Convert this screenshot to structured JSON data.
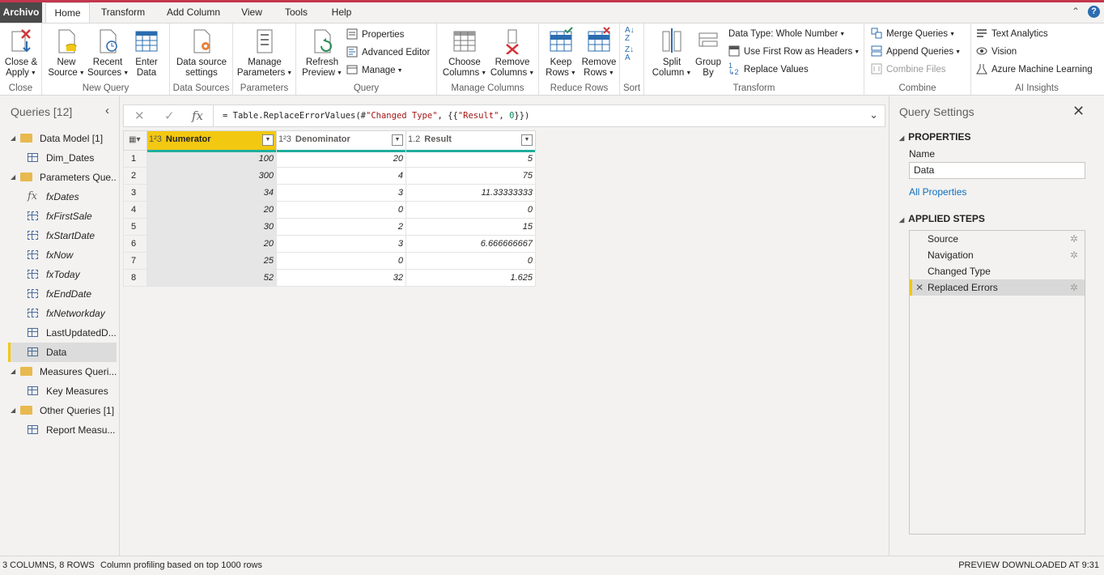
{
  "ribbon_tabs": {
    "file": "Archivo",
    "items": [
      "Home",
      "Transform",
      "Add Column",
      "View",
      "Tools",
      "Help"
    ],
    "active": "Home"
  },
  "ribbon": {
    "close": {
      "close_apply_1": "Close &",
      "close_apply_2": "Apply",
      "label": "Close"
    },
    "new_query": {
      "new_source_1": "New",
      "new_source_2": "Source",
      "recent_sources_1": "Recent",
      "recent_sources_2": "Sources",
      "enter_data_1": "Enter",
      "enter_data_2": "Data",
      "label": "New Query"
    },
    "data_sources": {
      "ds_settings_1": "Data source",
      "ds_settings_2": "settings",
      "label": "Data Sources"
    },
    "parameters": {
      "manage_1": "Manage",
      "manage_2": "Parameters",
      "label": "Parameters"
    },
    "query": {
      "refresh_1": "Refresh",
      "refresh_2": "Preview",
      "properties": "Properties",
      "advanced_editor": "Advanced Editor",
      "manage": "Manage",
      "label": "Query"
    },
    "manage_columns": {
      "choose_1": "Choose",
      "choose_2": "Columns",
      "remove_1": "Remove",
      "remove_2": "Columns",
      "label": "Manage Columns"
    },
    "reduce_rows": {
      "keep_1": "Keep",
      "keep_2": "Rows",
      "remove_1": "Remove",
      "remove_2": "Rows",
      "label": "Reduce Rows"
    },
    "sort": {
      "label": "Sort"
    },
    "transform": {
      "split_1": "Split",
      "split_2": "Column",
      "group_1": "Group",
      "group_2": "By",
      "data_type": "Data Type: Whole Number",
      "first_row": "Use First Row as Headers",
      "replace_values": "Replace Values",
      "label": "Transform"
    },
    "combine": {
      "merge": "Merge Queries",
      "append": "Append Queries",
      "combine_files": "Combine Files",
      "label": "Combine"
    },
    "ai": {
      "text_analytics": "Text Analytics",
      "vision": "Vision",
      "azure_ml": "Azure Machine Learning",
      "label": "AI Insights"
    }
  },
  "queries_panel": {
    "title": "Queries [12]",
    "items": [
      {
        "label": "Data Model [1]",
        "kind": "folder"
      },
      {
        "label": "Dim_Dates",
        "kind": "table"
      },
      {
        "label": "Parameters Que...",
        "kind": "folder"
      },
      {
        "label": "fxDates",
        "kind": "function"
      },
      {
        "label": "fxFirstSale",
        "kind": "param"
      },
      {
        "label": "fxStartDate",
        "kind": "param"
      },
      {
        "label": "fxNow",
        "kind": "param"
      },
      {
        "label": "fxToday",
        "kind": "param"
      },
      {
        "label": "fxEndDate",
        "kind": "param"
      },
      {
        "label": "fxNetworkday",
        "kind": "param"
      },
      {
        "label": "LastUpdatedD...",
        "kind": "table"
      },
      {
        "label": "Data",
        "kind": "table",
        "selected": true
      },
      {
        "label": "Measures Queri...",
        "kind": "folder"
      },
      {
        "label": "Key Measures",
        "kind": "table"
      },
      {
        "label": "Other Queries [1]",
        "kind": "folder"
      },
      {
        "label": "Report Measu...",
        "kind": "table"
      }
    ]
  },
  "formula_bar": {
    "prefix": "= Table.ReplaceErrorValues(#",
    "str1": "\"Changed Type\"",
    "mid": ", {{",
    "str2": "\"Result\"",
    "comma": ", ",
    "num": "0",
    "suffix": "}})"
  },
  "grid": {
    "columns": [
      {
        "type": "1²3",
        "name": "Numerator"
      },
      {
        "type": "1²3",
        "name": "Denominator"
      },
      {
        "type": "1.2",
        "name": "Result"
      }
    ],
    "rows": [
      [
        "1",
        "100",
        "20",
        "5"
      ],
      [
        "2",
        "300",
        "4",
        "75"
      ],
      [
        "3",
        "34",
        "3",
        "11.33333333"
      ],
      [
        "4",
        "20",
        "0",
        "0"
      ],
      [
        "5",
        "30",
        "2",
        "15"
      ],
      [
        "6",
        "20",
        "3",
        "6.666666667"
      ],
      [
        "7",
        "25",
        "0",
        "0"
      ],
      [
        "8",
        "52",
        "32",
        "1.625"
      ]
    ]
  },
  "query_settings": {
    "title": "Query Settings",
    "properties_header": "PROPERTIES",
    "name_label": "Name",
    "name_value": "Data",
    "all_properties": "All Properties",
    "applied_steps_header": "APPLIED STEPS",
    "steps": [
      "Source",
      "Navigation",
      "Changed Type",
      "Replaced Errors"
    ]
  },
  "status": {
    "left": "3 COLUMNS, 8 ROWS",
    "profiling": "Column profiling based on top 1000 rows",
    "right": "PREVIEW DOWNLOADED AT 9:31"
  },
  "colors": {
    "accent": "#f2c811",
    "brand": "#c4364c",
    "quality_bar": "#1fae9c"
  }
}
